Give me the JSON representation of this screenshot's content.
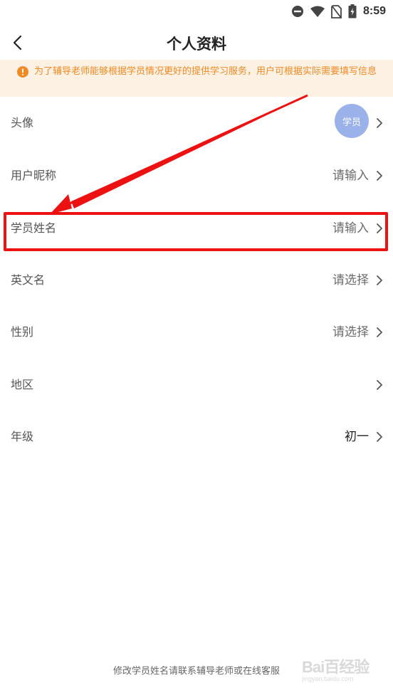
{
  "status_bar": {
    "time": "8:59",
    "icons": [
      "do-not-disturb-icon",
      "wifi-icon",
      "no-sim-icon",
      "battery-icon"
    ]
  },
  "header": {
    "title": "个人资料",
    "back_icon": "chevron-left-icon"
  },
  "notice": {
    "icon": "warning-circle-icon",
    "text": "为了辅导老师能够根据学员情况更好的提供学习服务，用户可根据实际需要填写信息",
    "color": "#f08a24",
    "background": "#fdf1e3"
  },
  "rows": [
    {
      "label": "头像",
      "value": "",
      "avatar_text": "学员"
    },
    {
      "label": "用户昵称",
      "value": "请输入"
    },
    {
      "label": "学员姓名",
      "value": "请输入"
    },
    {
      "label": "英文名",
      "value": "请选择"
    },
    {
      "label": "性别",
      "value": "请选择"
    },
    {
      "label": "地区",
      "value": ""
    },
    {
      "label": "年级",
      "value": "初一"
    }
  ],
  "footer": {
    "note": "修改学员姓名请联系辅导老师或在线客服"
  },
  "watermark": {
    "logo": "Bai百经验",
    "sub": "jingyan.baidu.com"
  },
  "colors": {
    "annotation_red": "#ee1111",
    "avatar_bg": "#9bb1ea"
  }
}
